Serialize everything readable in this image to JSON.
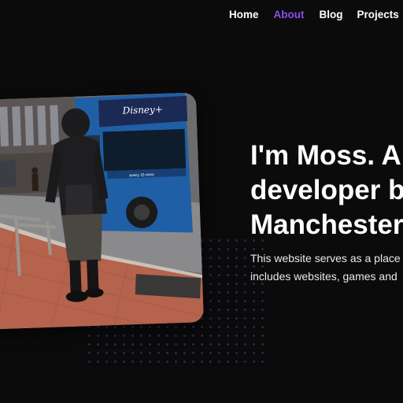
{
  "nav": {
    "items": [
      {
        "label": "Home",
        "active": false
      },
      {
        "label": "About",
        "active": true
      },
      {
        "label": "Blog",
        "active": false
      },
      {
        "label": "Projects",
        "active": false
      }
    ]
  },
  "hero": {
    "title_lines": [
      "I'm Moss. A",
      "developer b",
      "Manchester"
    ],
    "description_lines": [
      "This website serves as a place",
      "includes websites, games and"
    ]
  },
  "photo": {
    "bus_brand": "Disney+",
    "bus_side_text": "every 15 mins"
  },
  "colors": {
    "background": "#0b0b0c",
    "accent": "#8a4fe8",
    "text": "#ffffff",
    "dots": "#2a2a66"
  }
}
